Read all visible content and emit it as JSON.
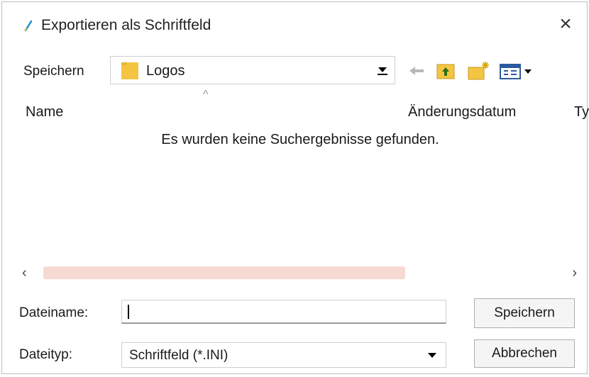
{
  "window": {
    "title": "Exportieren als Schriftfeld",
    "close_label": "×",
    "app_icon": "pencil-icon"
  },
  "toolbar": {
    "lookin_label": "Speichern",
    "lookin_value": "Logos",
    "folder_icon": "folder-icon",
    "back_icon": "back-arrow-icon",
    "up_icon": "up-folder-icon",
    "new_folder_icon": "new-folder-icon",
    "view_icon": "view-menu-icon"
  },
  "list": {
    "sort_caret": "^",
    "columns": [
      "Name",
      "Änderungsdatum",
      "Ty"
    ],
    "empty_message": "Es wurden keine Suchergebnisse gefunden."
  },
  "scroll": {
    "left": "‹",
    "right": "›"
  },
  "form": {
    "filename_label": "Dateiname:",
    "filename_value": "",
    "filetype_label": "Dateityp:",
    "filetype_value": "Schriftfeld (*.INI)",
    "save_label": "Speichern",
    "cancel_label": "Abbrechen"
  },
  "colors": {
    "folder": "#f4c542",
    "scroll_thumb": "#f6d9d2",
    "title_icon": "#1e8fd1"
  }
}
